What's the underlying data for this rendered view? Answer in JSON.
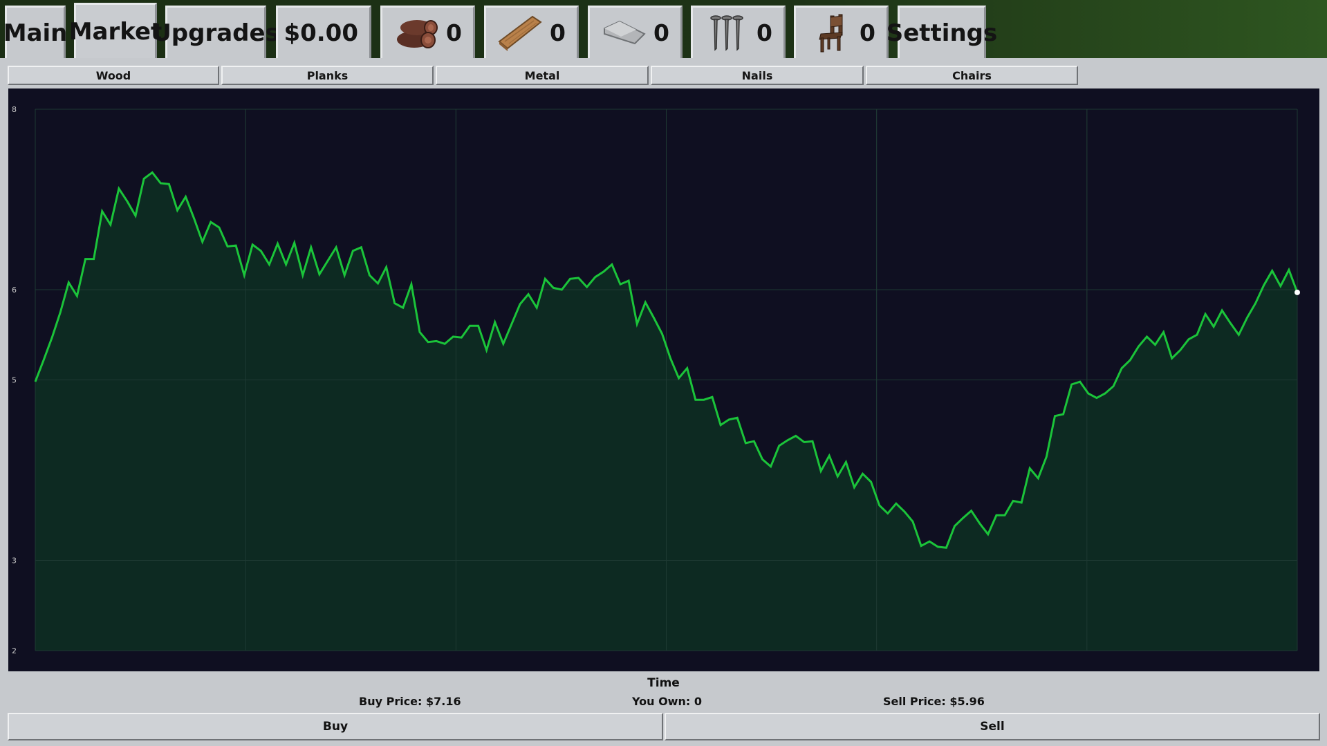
{
  "top_tabs": {
    "main": "Main",
    "market": "Market",
    "upgrades": "Upgrades",
    "settings": "Settings"
  },
  "money": "$0.00",
  "resources": [
    {
      "name": "wood",
      "icon": "wood-logs-icon",
      "count": "0"
    },
    {
      "name": "planks",
      "icon": "plank-icon",
      "count": "0"
    },
    {
      "name": "metal",
      "icon": "metal-ingot-icon",
      "count": "0"
    },
    {
      "name": "nails",
      "icon": "nails-icon",
      "count": "0"
    },
    {
      "name": "chairs",
      "icon": "chair-icon",
      "count": "0"
    }
  ],
  "market_tabs": [
    "Wood",
    "Planks",
    "Metal",
    "Nails",
    "Chairs"
  ],
  "chart_data": {
    "type": "area",
    "xlabel": "Time",
    "ylabel": "",
    "ylim": [
      2,
      8
    ],
    "yticks": [
      2,
      3,
      5,
      6,
      8
    ],
    "grid": true,
    "line_color": "#1bc43a",
    "fill_color": "#0d2a22",
    "values": [
      4.98,
      5.22,
      5.47,
      5.75,
      6.08,
      5.93,
      6.34,
      6.34,
      6.87,
      6.72,
      7.12,
      6.98,
      6.82,
      7.23,
      7.3,
      7.18,
      7.17,
      6.88,
      7.03,
      6.79,
      6.53,
      6.75,
      6.69,
      6.48,
      6.49,
      6.16,
      6.5,
      6.43,
      6.28,
      6.51,
      6.28,
      6.52,
      6.16,
      6.47,
      6.17,
      6.32,
      6.47,
      6.16,
      6.43,
      6.47,
      6.16,
      6.07,
      6.25,
      5.85,
      5.8,
      6.06,
      5.53,
      5.42,
      5.43,
      5.4,
      5.48,
      5.47,
      5.6,
      5.6,
      5.33,
      5.64,
      5.4,
      5.62,
      5.84,
      5.95,
      5.8,
      6.12,
      6.02,
      6.0,
      6.12,
      6.13,
      6.03,
      6.14,
      6.2,
      6.28,
      6.06,
      6.1,
      5.62,
      5.86,
      5.69,
      5.51,
      5.24,
      5.02,
      5.13,
      4.78,
      4.78,
      4.81,
      4.5,
      4.56,
      4.58,
      4.3,
      4.32,
      4.12,
      4.04,
      4.27,
      4.33,
      4.38,
      4.31,
      4.32,
      3.99,
      4.16,
      3.93,
      4.09,
      3.81,
      3.96,
      3.87,
      3.61,
      3.52,
      3.63,
      3.54,
      3.43,
      3.16,
      3.21,
      3.15,
      3.14,
      3.38,
      3.47,
      3.55,
      3.41,
      3.29,
      3.5,
      3.5,
      3.66,
      3.64,
      4.02,
      3.91,
      4.15,
      4.6,
      4.62,
      4.95,
      4.98,
      4.85,
      4.8,
      4.85,
      4.93,
      5.13,
      5.22,
      5.37,
      5.48,
      5.39,
      5.53,
      5.24,
      5.33,
      5.45,
      5.5,
      5.73,
      5.59,
      5.77,
      5.63,
      5.5,
      5.69,
      5.85,
      6.05,
      6.21,
      6.04,
      6.22,
      5.97
    ]
  },
  "bottom": {
    "buy_price": "Buy Price: $7.16",
    "you_own": "You Own: 0",
    "sell_price": "Sell Price: $5.96",
    "buy_label": "Buy",
    "sell_label": "Sell"
  }
}
